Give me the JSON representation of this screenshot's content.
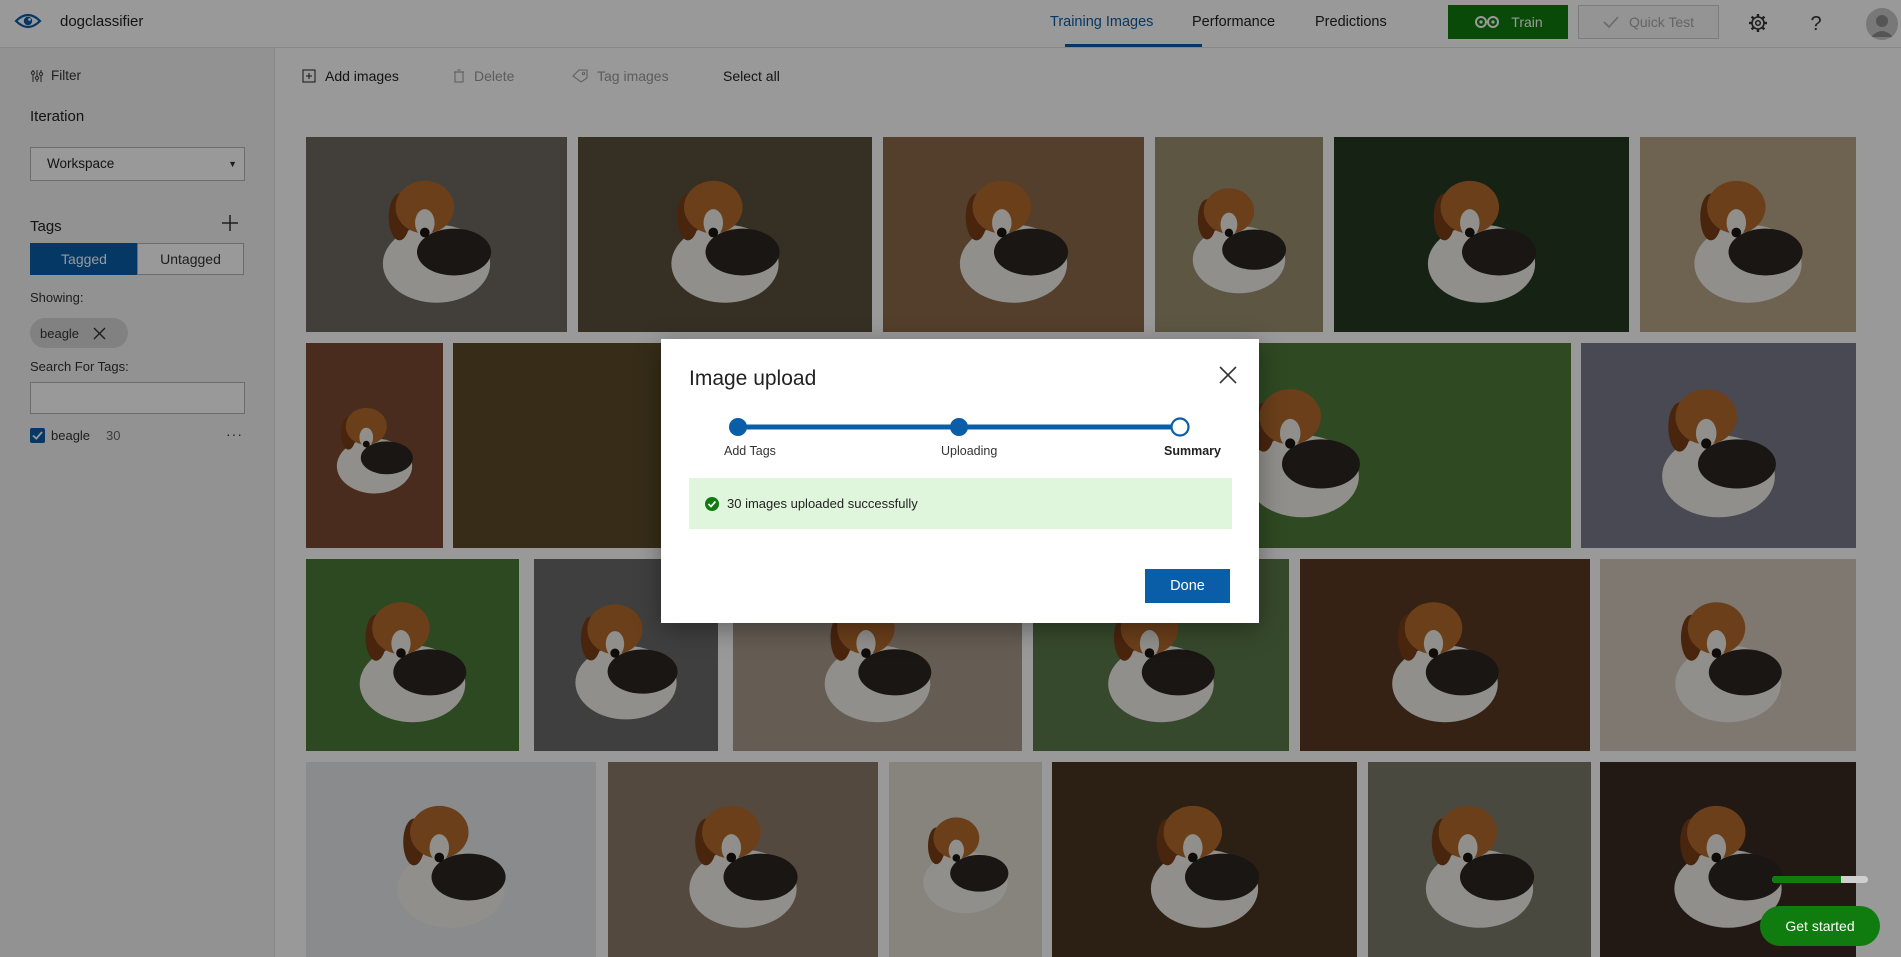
{
  "app": {
    "name": "dogclassifier"
  },
  "nav": {
    "tabs": [
      {
        "label": "Training Images",
        "active": true
      },
      {
        "label": "Performance",
        "active": false
      },
      {
        "label": "Predictions",
        "active": false
      }
    ],
    "train_label": "Train",
    "quick_test_label": "Quick Test",
    "icons": [
      "gear-icon",
      "help-icon",
      "avatar"
    ]
  },
  "sidebar": {
    "filter_label": "Filter",
    "iteration_heading": "Iteration",
    "iteration_value": "Workspace",
    "tags_heading": "Tags",
    "segments": {
      "tagged": "Tagged",
      "untagged": "Untagged",
      "selected": "Tagged"
    },
    "showing_label": "Showing:",
    "active_filter_chip": "beagle",
    "search_label": "Search For Tags:",
    "search_value": "",
    "tags": [
      {
        "name": "beagle",
        "count": "30",
        "checked": true
      }
    ]
  },
  "toolbar": {
    "add_images": "Add images",
    "delete": "Delete",
    "tag_images": "Tag images",
    "select_all": "Select all"
  },
  "modal": {
    "title": "Image upload",
    "steps": [
      {
        "label": "Add Tags",
        "state": "done"
      },
      {
        "label": "Uploading",
        "state": "done"
      },
      {
        "label": "Summary",
        "state": "current"
      }
    ],
    "message": "30 images uploaded successfully",
    "done_label": "Done"
  },
  "get_started_label": "Get started",
  "get_started_progress": 0.72,
  "colors": {
    "accent": "#0a5ea8",
    "train_green": "#107c10",
    "success_bg": "#dff6dd",
    "overlay": "rgba(0,0,0,0.40)"
  }
}
